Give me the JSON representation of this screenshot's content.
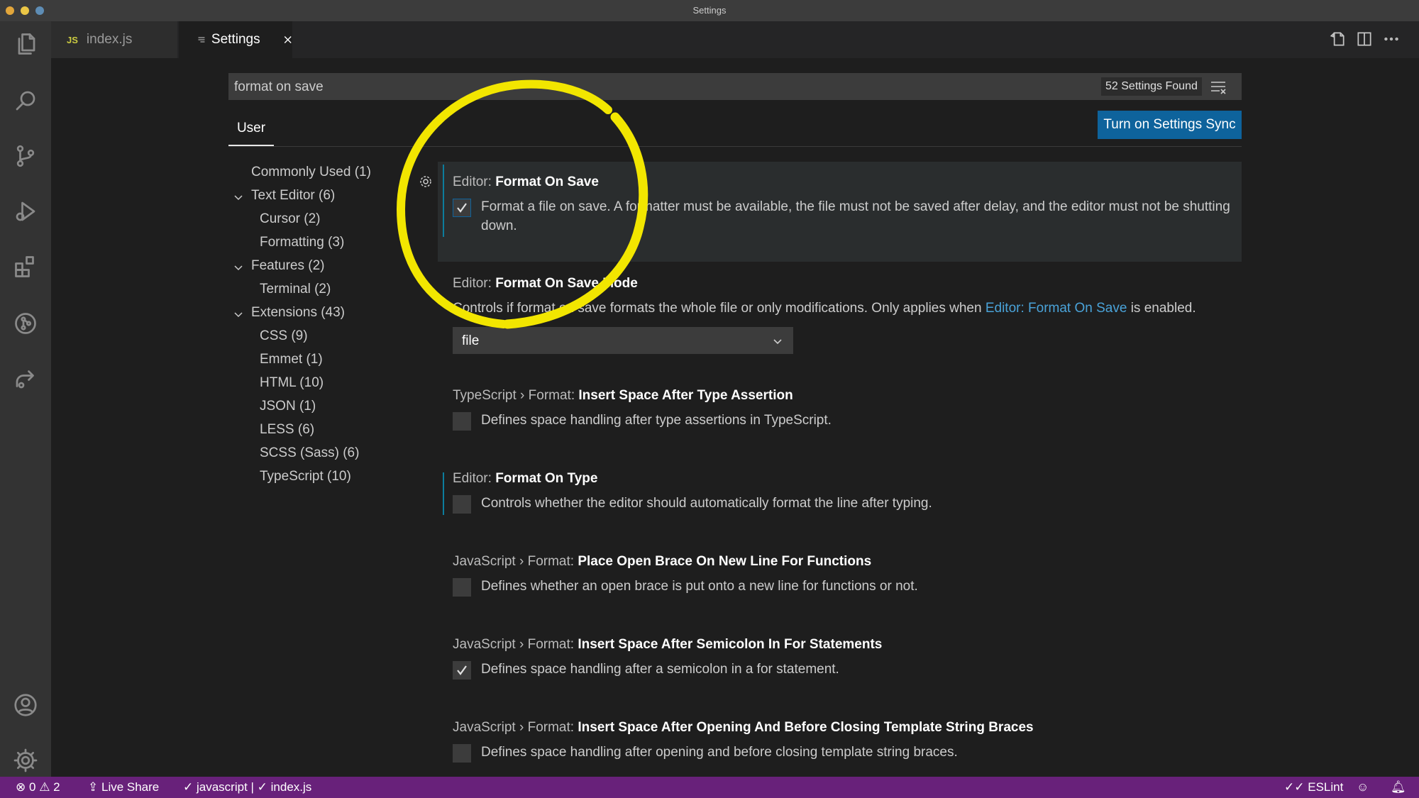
{
  "window": {
    "title": "Settings"
  },
  "tabs": [
    {
      "badge": "JS",
      "label": "index.js"
    },
    {
      "label": "Settings"
    }
  ],
  "search": {
    "value": "format on save",
    "found": "52 Settings Found"
  },
  "scope_tab": "User",
  "sync_button": "Turn on Settings Sync",
  "toc": [
    {
      "label": "Commonly Used (1)"
    },
    {
      "label": "Text Editor (6)"
    },
    {
      "label": "Cursor (2)"
    },
    {
      "label": "Formatting (3)"
    },
    {
      "label": "Features (2)"
    },
    {
      "label": "Terminal (2)"
    },
    {
      "label": "Extensions (43)"
    },
    {
      "label": "CSS (9)"
    },
    {
      "label": "Emmet (1)"
    },
    {
      "label": "HTML (10)"
    },
    {
      "label": "JSON (1)"
    },
    {
      "label": "LESS (6)"
    },
    {
      "label": "SCSS (Sass) (6)"
    },
    {
      "label": "TypeScript (10)"
    }
  ],
  "settings": [
    {
      "category": "Editor: ",
      "name": "Format On Save",
      "desc": "Format a file on save. A formatter must be available, the file must not be saved after delay, and the editor must not be shutting down.",
      "checked": true
    },
    {
      "category": "Editor: ",
      "name": "Format On Save Mode",
      "desc_before": "Controls if format on save formats the whole file or only modifications. Only applies when ",
      "desc_link": "Editor: Format On Save",
      "desc_after": " is enabled.",
      "value": "file"
    },
    {
      "category": "TypeScript › Format: ",
      "name": "Insert Space After Type Assertion",
      "desc": "Defines space handling after type assertions in TypeScript.",
      "checked": false
    },
    {
      "category": "Editor: ",
      "name": "Format On Type",
      "desc": "Controls whether the editor should automatically format the line after typing.",
      "checked": false
    },
    {
      "category": "JavaScript › Format: ",
      "name": "Place Open Brace On New Line For Functions",
      "desc": "Defines whether an open brace is put onto a new line for functions or not.",
      "checked": false
    },
    {
      "category": "JavaScript › Format: ",
      "name": "Insert Space After Semicolon In For Statements",
      "desc": "Defines space handling after a semicolon in a for statement.",
      "checked": true
    },
    {
      "category": "JavaScript › Format: ",
      "name": "Insert Space After Opening And Before Closing Template String Braces",
      "desc": "Defines space handling after opening and before closing template string braces.",
      "checked": false
    }
  ],
  "statusbar": {
    "errors": "0",
    "warnings": "2",
    "live_share": "Live Share",
    "language": "javascript | ",
    "file": "index.js",
    "eslint": "ESLint"
  },
  "colors": {
    "statusbar": "#68217a",
    "button": "#0e639c",
    "highlight": "#f2e600"
  }
}
